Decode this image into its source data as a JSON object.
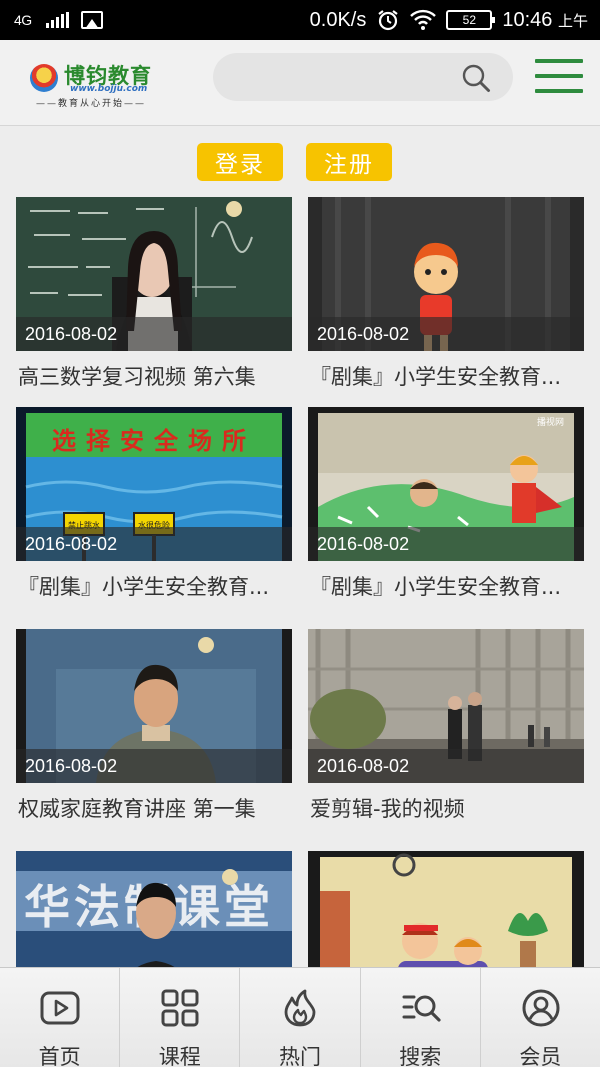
{
  "status_bar": {
    "network": "4G",
    "net_speed": "0.0K/s",
    "battery": "52",
    "time": "10:46",
    "ampm": "上午"
  },
  "header": {
    "logo_name": "博钧教育",
    "logo_url": "www.bojju.com",
    "logo_slogan": "——教育从心开始——",
    "search_placeholder": ""
  },
  "auth": {
    "login": "登录",
    "register": "注册"
  },
  "videos": [
    {
      "date": "2016-08-02",
      "title": "高三数学复习视频 第六集"
    },
    {
      "date": "2016-08-02",
      "title": "『剧集』小学生安全教育..."
    },
    {
      "date": "2016-08-02",
      "title": "『剧集』小学生安全教育..."
    },
    {
      "date": "2016-08-02",
      "title": "『剧集』小学生安全教育..."
    },
    {
      "date": "2016-08-02",
      "title": "权威家庭教育讲座 第一集"
    },
    {
      "date": "2016-08-02",
      "title": "爱剪辑-我的视频"
    },
    {
      "date": "",
      "title": ""
    },
    {
      "date": "",
      "title": ""
    }
  ],
  "thumb_texts": {
    "safety_banner": "选择安全场所",
    "sign_left": "禁止跳水",
    "sign_right": "水很危险",
    "tv_watermark": "播视网",
    "law_banner": "华法制课堂"
  },
  "bottom_nav": [
    {
      "label": "首页",
      "icon": "play-icon"
    },
    {
      "label": "课程",
      "icon": "grid-icon"
    },
    {
      "label": "热门",
      "icon": "flame-icon"
    },
    {
      "label": "搜索",
      "icon": "search-list-icon"
    },
    {
      "label": "会员",
      "icon": "user-icon"
    }
  ],
  "colors": {
    "accent_green": "#2e8b3e",
    "button_yellow": "#f7c300"
  }
}
